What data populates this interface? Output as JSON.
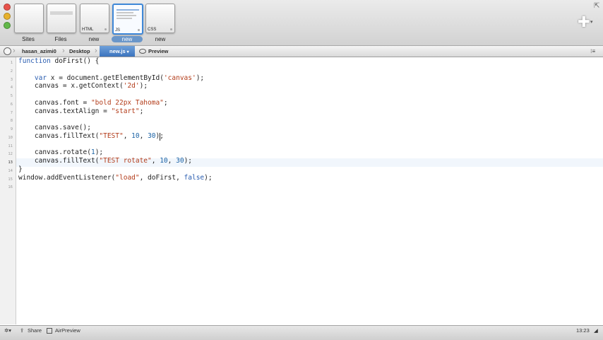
{
  "window": {
    "documents": [
      {
        "label": "Sites",
        "tag": ""
      },
      {
        "label": "Files",
        "tag": ""
      },
      {
        "label": "new",
        "tag": "HTML"
      },
      {
        "label": "new",
        "tag": "JS"
      },
      {
        "label": "new",
        "tag": "CSS"
      }
    ],
    "active_document": 3,
    "add_icon": "plus-icon"
  },
  "pathbar": {
    "crumbs": [
      "hasan_azimi0",
      "Desktop",
      "new.js"
    ],
    "preview_label": "Preview"
  },
  "editor": {
    "line_numbers": [
      "1",
      "2",
      "3",
      "4",
      "5",
      "6",
      "7",
      "8",
      "9",
      "10",
      "11",
      "12",
      "13",
      "14",
      "15",
      "16"
    ],
    "current_line": 13,
    "language": "JavaScript"
  },
  "statusbar": {
    "share_label": "Share",
    "airpreview_label": "AirPreview",
    "time": "13:23"
  },
  "colors": {
    "keyword": "#2a5db0",
    "string": "#b33c1a",
    "number": "#1a62a5",
    "accent": "#3b73bd"
  }
}
